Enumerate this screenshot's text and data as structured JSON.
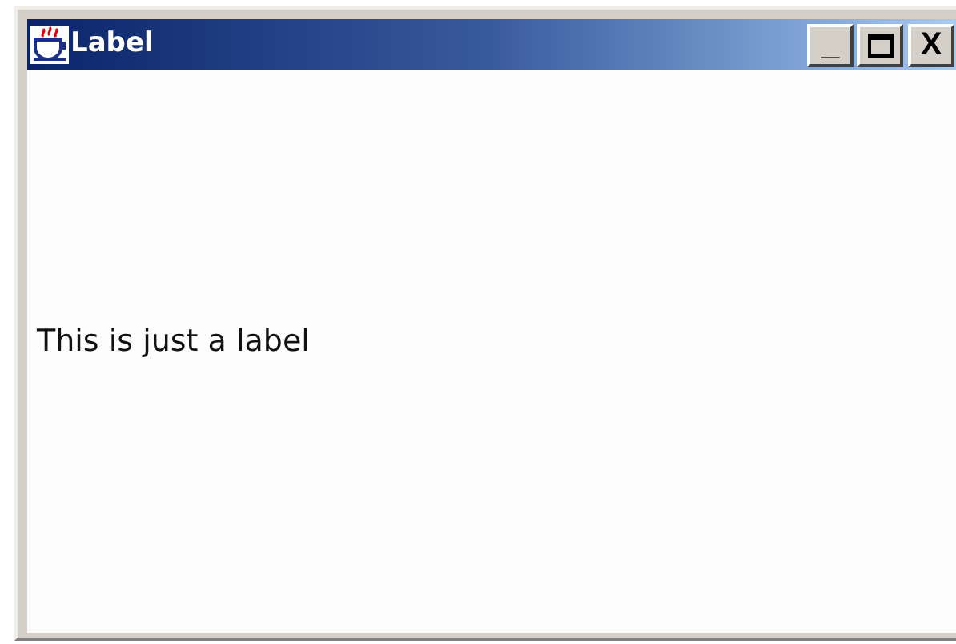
{
  "window": {
    "title": "Label",
    "controls": [
      {
        "kind": "minimize",
        "label": "_"
      },
      {
        "kind": "maximize"
      },
      {
        "kind": "close",
        "label": "X"
      }
    ]
  },
  "content": {
    "label": "This is just a label"
  }
}
